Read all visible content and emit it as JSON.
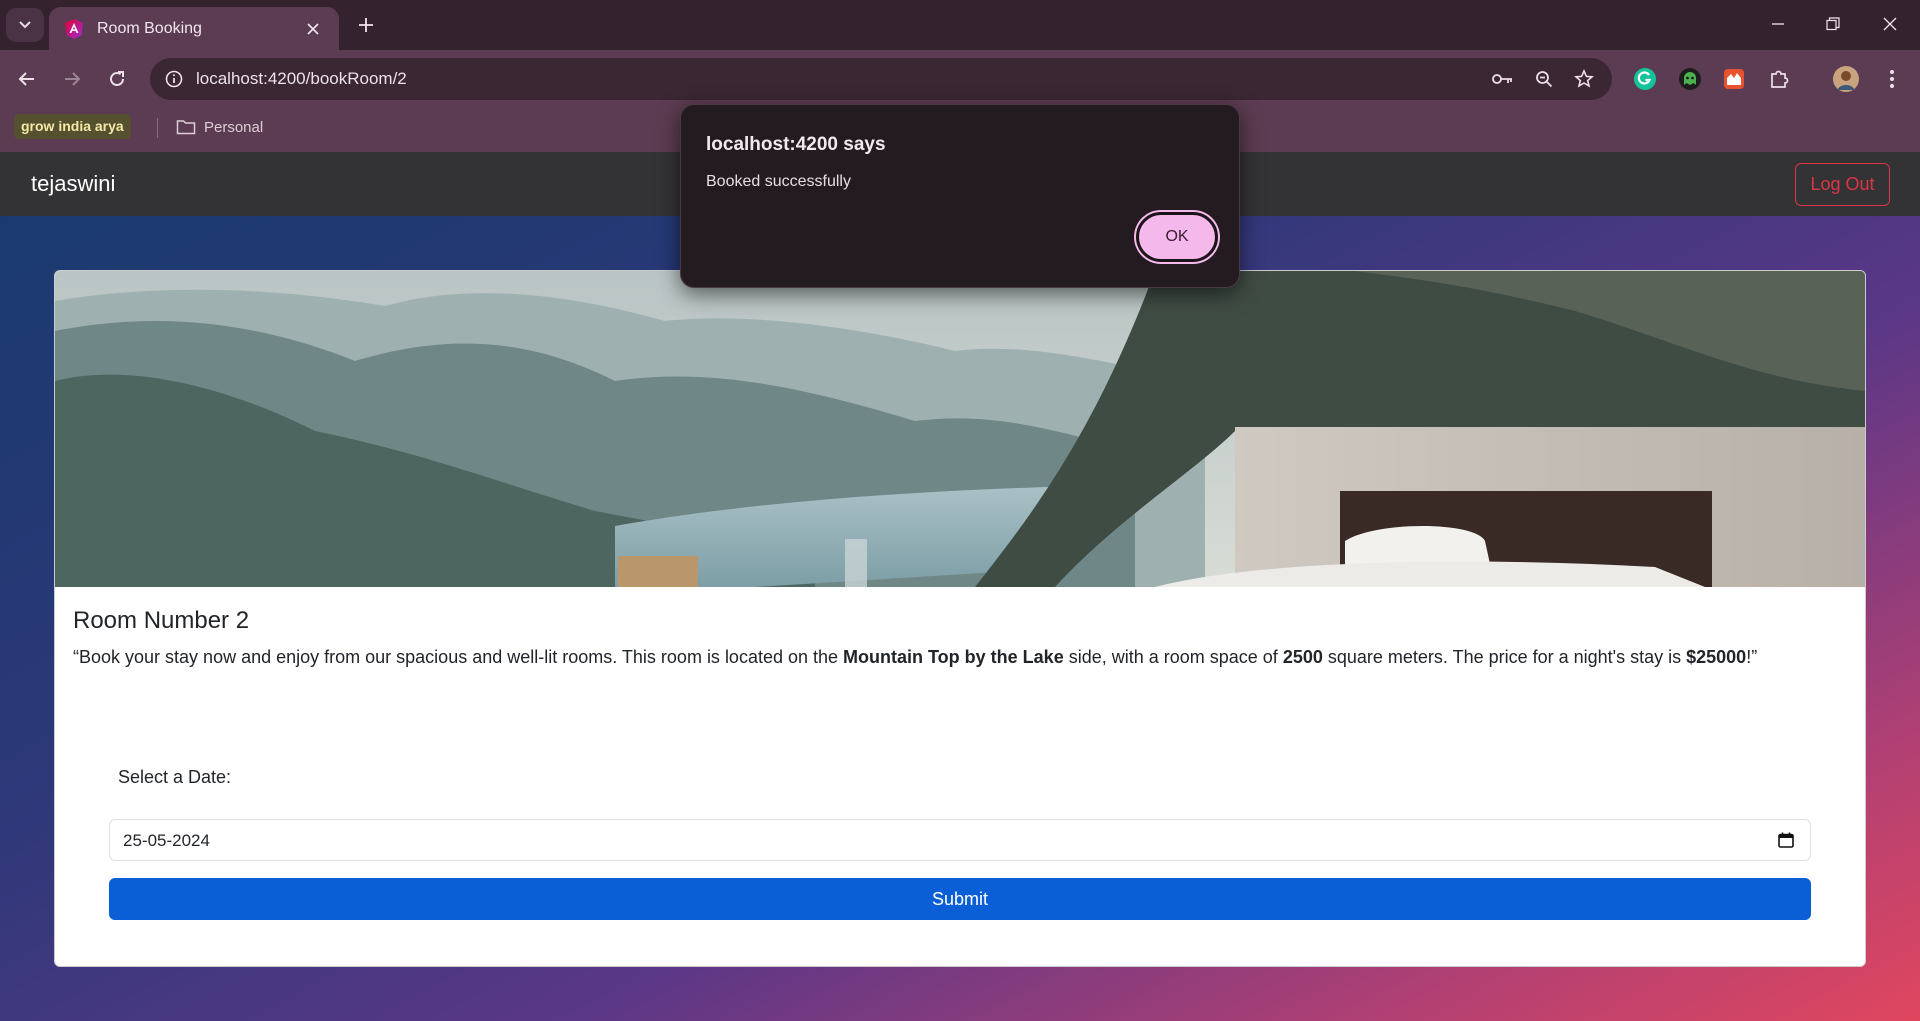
{
  "browser": {
    "tab_title": "Room Booking",
    "url": "localhost:4200/bookRoom/2",
    "bookmarks": {
      "grow": "grow india arya",
      "folder": "Personal"
    }
  },
  "navbar": {
    "brand": "tejaswini",
    "logout_label": "Log Out"
  },
  "room": {
    "title": "Room Number 2",
    "desc_open": "“Book your stay now and enjoy from our spacious and well-lit rooms. This room is located on the ",
    "location": "Mountain Top by the Lake",
    "desc_mid": " side, with a room space of ",
    "space": "2500",
    "desc_mid2": " square meters. The price for a night's stay is ",
    "price": "$25000",
    "desc_close": "!”"
  },
  "form": {
    "date_label": "Select a Date:",
    "date_value": "25-05-2024",
    "submit_label": "Submit"
  },
  "dialog": {
    "title": "localhost:4200 says",
    "message": "Booked successfully",
    "ok_label": "OK"
  },
  "colors": {
    "accent_button": "#0a5ed6",
    "logout": "#dc3545",
    "dialog_ok": "#f5b8ea"
  }
}
